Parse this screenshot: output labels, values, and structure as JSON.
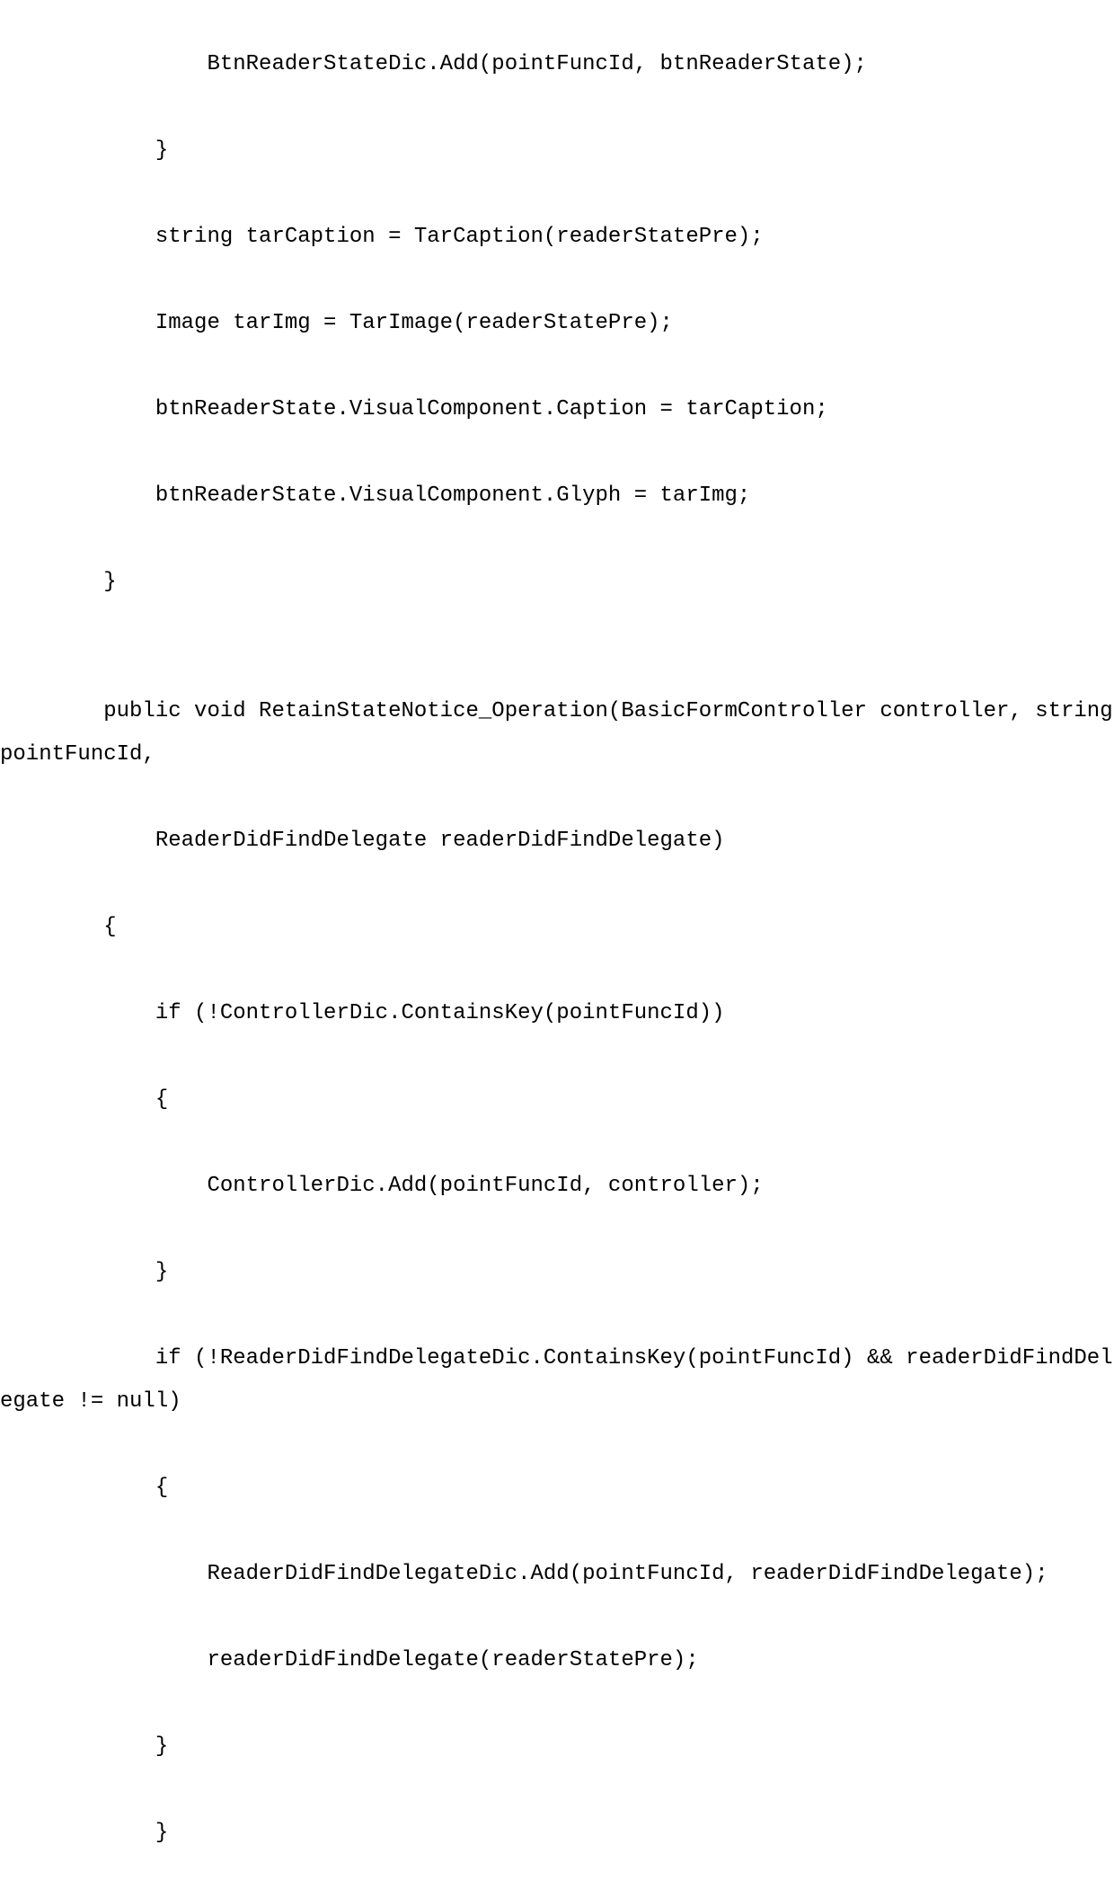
{
  "code": {
    "lines": [
      "                BtnReaderStateDic.Add(pointFuncId, btnReaderState);",
      "            }",
      "            string tarCaption = TarCaption(readerStatePre);",
      "            Image tarImg = TarImage(readerStatePre);",
      "            btnReaderState.VisualComponent.Caption = tarCaption;",
      "            btnReaderState.VisualComponent.Glyph = tarImg;",
      "        }",
      "",
      "        public void RetainStateNotice_Operation(BasicFormController controller, string pointFuncId,",
      "            ReaderDidFindDelegate readerDidFindDelegate)",
      "        {",
      "            if (!ControllerDic.ContainsKey(pointFuncId))",
      "            {",
      "                ControllerDic.Add(pointFuncId, controller);",
      "            }",
      "            if (!ReaderDidFindDelegateDic.ContainsKey(pointFuncId) && readerDidFindDelegate != null)",
      "            {",
      "                ReaderDidFindDelegateDic.Add(pointFuncId, readerDidFindDelegate);",
      "                readerDidFindDelegate(readerStatePre);",
      "            }",
      "            }"
    ]
  }
}
